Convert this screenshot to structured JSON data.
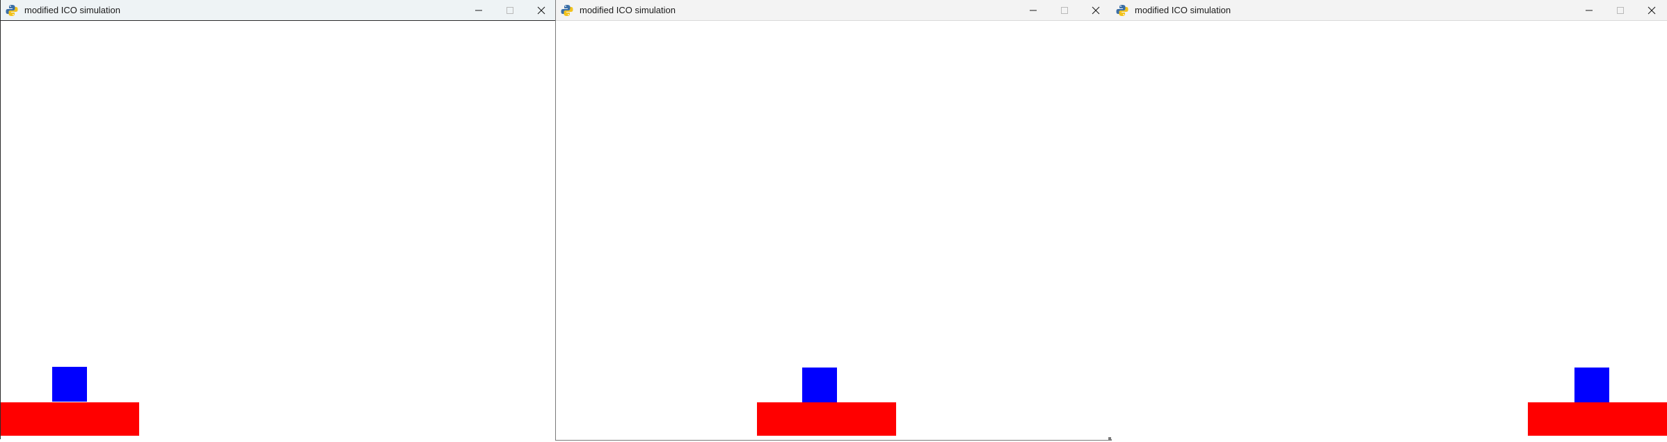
{
  "windows": [
    {
      "title": "modified ICO simulation",
      "icon": "python-snake-icon",
      "controls": {
        "minimize": "minimize-icon",
        "maximize": "maximize-icon",
        "close": "close-icon"
      },
      "scene": {
        "platform_color": "#ff0000",
        "cube_color": "#0000ff",
        "background": "#ffffff"
      }
    },
    {
      "title": "modified ICO simulation",
      "icon": "python-snake-icon",
      "controls": {
        "minimize": "minimize-icon",
        "maximize": "maximize-icon",
        "close": "close-icon"
      },
      "scene": {
        "platform_color": "#ff0000",
        "cube_color": "#0000ff",
        "background": "#ffffff"
      }
    },
    {
      "title": "modified ICO simulation",
      "icon": "python-snake-icon",
      "controls": {
        "minimize": "minimize-icon",
        "maximize": "maximize-icon",
        "close": "close-icon"
      },
      "scene": {
        "platform_color": "#ff0000",
        "cube_color": "#0000ff",
        "background": "#ffffff"
      }
    }
  ]
}
